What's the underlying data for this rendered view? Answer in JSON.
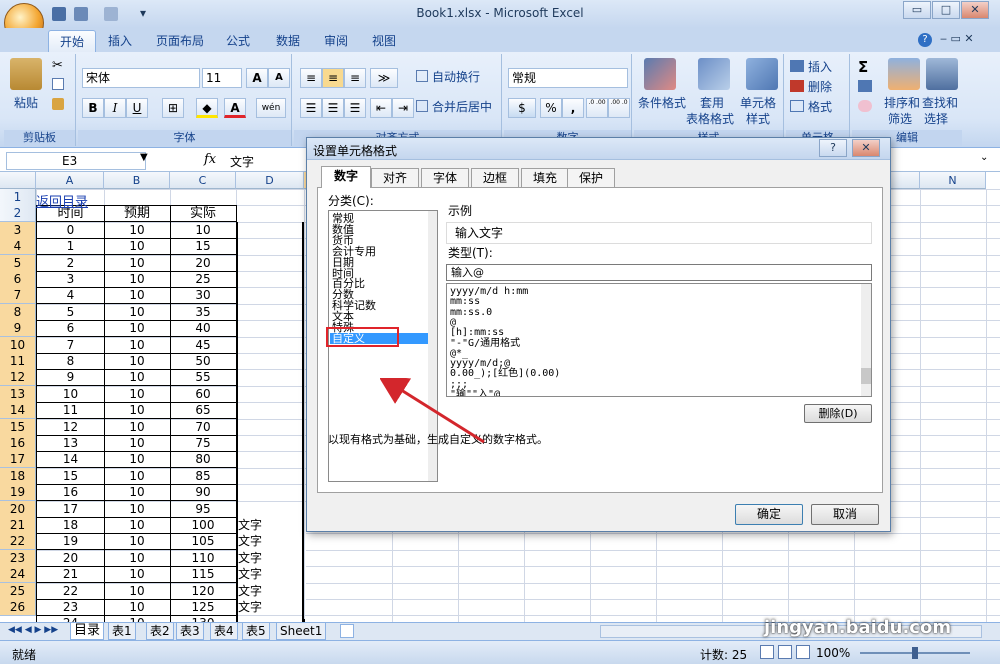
{
  "window": {
    "title": "Book1.xlsx - Microsoft Excel",
    "min": "▭",
    "max": "□",
    "close": "✕"
  },
  "ribbon_tabs": [
    "开始",
    "插入",
    "页面布局",
    "公式",
    "数据",
    "审阅",
    "视图"
  ],
  "ribbon": {
    "clipboard": {
      "label": "剪贴板",
      "paste": "粘贴"
    },
    "font": {
      "label": "字体",
      "name": "宋体",
      "size": "11",
      "grow": "A",
      "shrink": "A",
      "bold": "B",
      "italic": "I",
      "underline": "U",
      "wen": "wén",
      "color_a": "A"
    },
    "alignment": {
      "label": "对齐方式",
      "wrap": "自动换行",
      "merge": "合并后居中"
    },
    "number": {
      "label": "数字",
      "format": "常规",
      "percent": "%",
      "comma": ",",
      "dec_inc": ".0 .00",
      "dec_dec": ".00 .0"
    },
    "styles": {
      "label": "样式",
      "cond": "条件格式",
      "table_1": "套用",
      "table_2": "表格格式",
      "cell_1": "单元格",
      "cell_2": "样式"
    },
    "cells": {
      "label": "单元格",
      "insert": "插入",
      "delete": "删除",
      "format": "格式"
    },
    "editing": {
      "label": "编辑",
      "sigma": "Σ",
      "sort_1": "排序和",
      "sort_2": "筛选",
      "find_1": "查找和",
      "find_2": "选择"
    }
  },
  "formula_bar": {
    "namebox": "E3",
    "fx": "fx",
    "content": "文字"
  },
  "sheet": {
    "columns": [
      "A",
      "B",
      "C",
      "D",
      "E",
      "F",
      "G",
      "H",
      "I",
      "J",
      "K",
      "L",
      "M",
      "N"
    ],
    "link": "返回目录",
    "headers": [
      "时间",
      "预期",
      "实际"
    ],
    "rows": [
      [
        "0",
        "10",
        "10"
      ],
      [
        "1",
        "10",
        "15"
      ],
      [
        "2",
        "10",
        "20"
      ],
      [
        "3",
        "10",
        "25"
      ],
      [
        "4",
        "10",
        "30"
      ],
      [
        "5",
        "10",
        "35"
      ],
      [
        "6",
        "10",
        "40"
      ],
      [
        "7",
        "10",
        "45"
      ],
      [
        "8",
        "10",
        "50"
      ],
      [
        "9",
        "10",
        "55"
      ],
      [
        "10",
        "10",
        "60"
      ],
      [
        "11",
        "10",
        "65"
      ],
      [
        "12",
        "10",
        "70"
      ],
      [
        "13",
        "10",
        "75"
      ],
      [
        "14",
        "10",
        "80"
      ],
      [
        "15",
        "10",
        "85"
      ],
      [
        "16",
        "10",
        "90"
      ],
      [
        "17",
        "10",
        "95"
      ],
      [
        "18",
        "10",
        "100"
      ],
      [
        "19",
        "10",
        "105"
      ],
      [
        "20",
        "10",
        "110"
      ],
      [
        "21",
        "10",
        "115"
      ],
      [
        "22",
        "10",
        "120"
      ],
      [
        "23",
        "10",
        "125"
      ],
      [
        "24",
        "10",
        "130"
      ]
    ],
    "e_values": [
      "文字",
      "文字",
      "文字",
      "文字",
      "文字",
      "文字"
    ],
    "row_numbers": [
      "1",
      "2",
      "3",
      "4",
      "5",
      "6",
      "7",
      "8",
      "9",
      "10",
      "11",
      "12",
      "13",
      "14",
      "15",
      "16",
      "17",
      "18",
      "19",
      "20",
      "21",
      "22",
      "23",
      "24",
      "25",
      "26"
    ]
  },
  "sheet_tabs": [
    "目录",
    "表1",
    "表2",
    "表3",
    "表4",
    "表5",
    "Sheet1"
  ],
  "status": {
    "ready": "就绪",
    "count": "计数: 25",
    "zoom": "100%"
  },
  "watermark": {
    "site": "jingyan.baidu.com"
  },
  "dialog": {
    "title": "设置单元格格式",
    "help": "?",
    "close": "✕",
    "tabs": [
      "数字",
      "对齐",
      "字体",
      "边框",
      "填充",
      "保护"
    ],
    "category_label": "分类(C):",
    "categories": [
      "常规",
      "数值",
      "货币",
      "会计专用",
      "日期",
      "时间",
      "百分比",
      "分数",
      "科学记数",
      "文本",
      "特殊",
      "自定义"
    ],
    "sample_label": "示例",
    "sample_value": "输入文字",
    "type_label": "类型(T):",
    "type_value": "输入@",
    "type_list": [
      "yyyy/m/d h:mm",
      "mm:ss",
      "mm:ss.0",
      "@",
      "[h]:mm:ss",
      "\"-\"G/通用格式",
      "@*_",
      "yyyy/m/d;@",
      "0.00_);[红色](0.00)",
      ";;;",
      "\"输\"\"入\"@"
    ],
    "delete": "删除(D)",
    "description": "以现有格式为基础，生成自定义的数字格式。",
    "ok": "确定",
    "cancel": "取消"
  },
  "colors": {
    "selected_row_header": "#f9d99f",
    "highlight_box": "#e0242a",
    "arrow": "#d3262c",
    "list_selection": "#3399ff"
  }
}
